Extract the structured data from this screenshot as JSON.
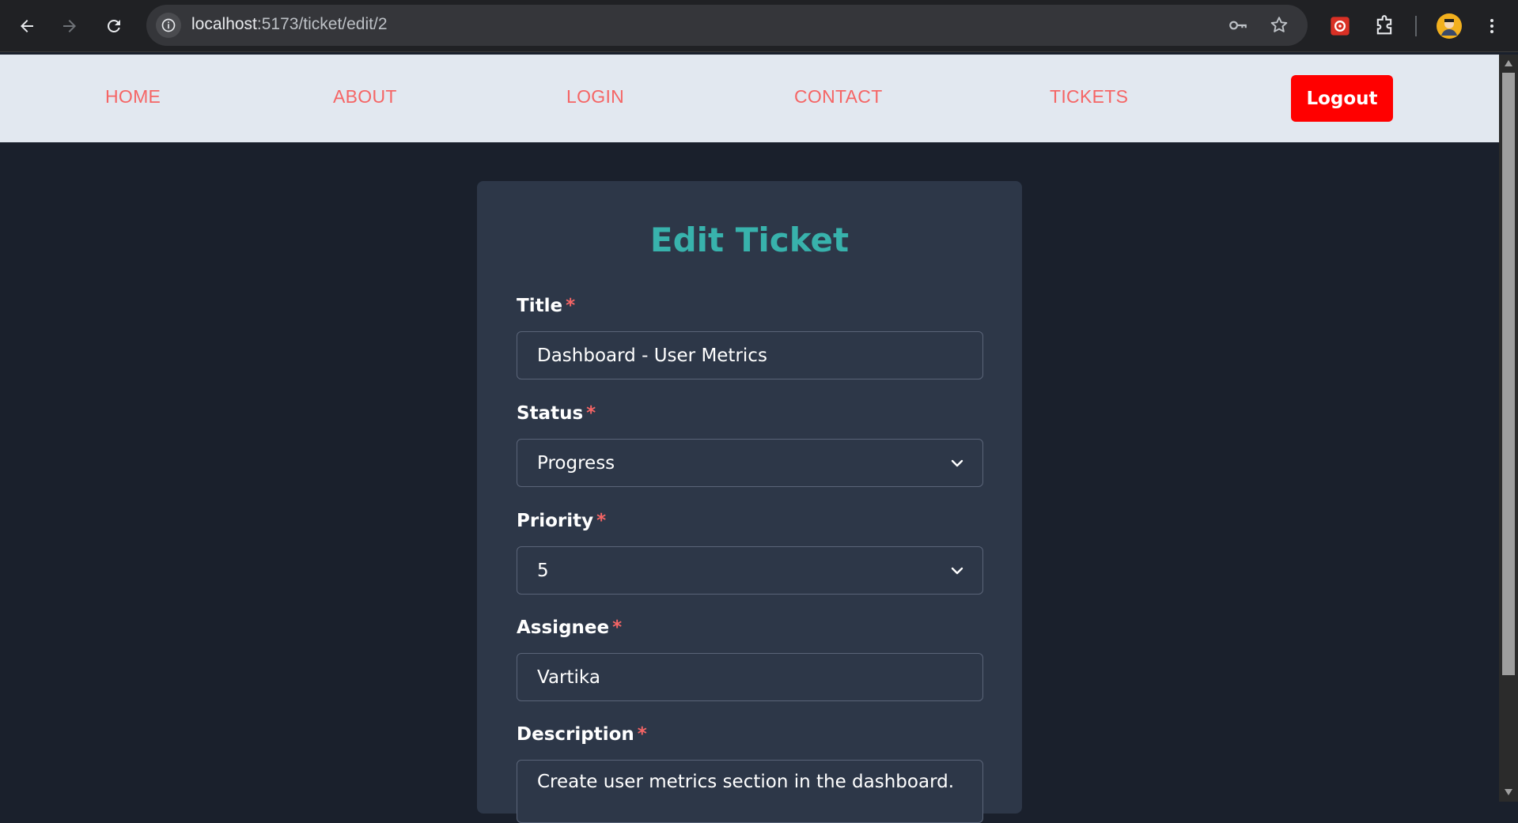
{
  "browser": {
    "url_host": "localhost",
    "url_path": ":5173/ticket/edit/2"
  },
  "nav": {
    "links": [
      "HOME",
      "ABOUT",
      "LOGIN",
      "CONTACT",
      "TICKETS"
    ],
    "logout_label": "Logout"
  },
  "form": {
    "heading": "Edit Ticket",
    "required_marker": "*",
    "title": {
      "label": "Title",
      "value": "Dashboard - User Metrics"
    },
    "status": {
      "label": "Status",
      "value": "Progress"
    },
    "priority": {
      "label": "Priority",
      "value": "5"
    },
    "assignee": {
      "label": "Assignee",
      "value": "Vartika"
    },
    "description": {
      "label": "Description",
      "value": "Create user metrics section in the dashboard."
    }
  },
  "colors": {
    "page_bg": "#1a202c",
    "card_bg": "#2d3748",
    "heading": "#38b2ac",
    "nav_link": "#f56565",
    "logout_bg": "#ff0000",
    "nav_bg": "#e2e8f0"
  }
}
